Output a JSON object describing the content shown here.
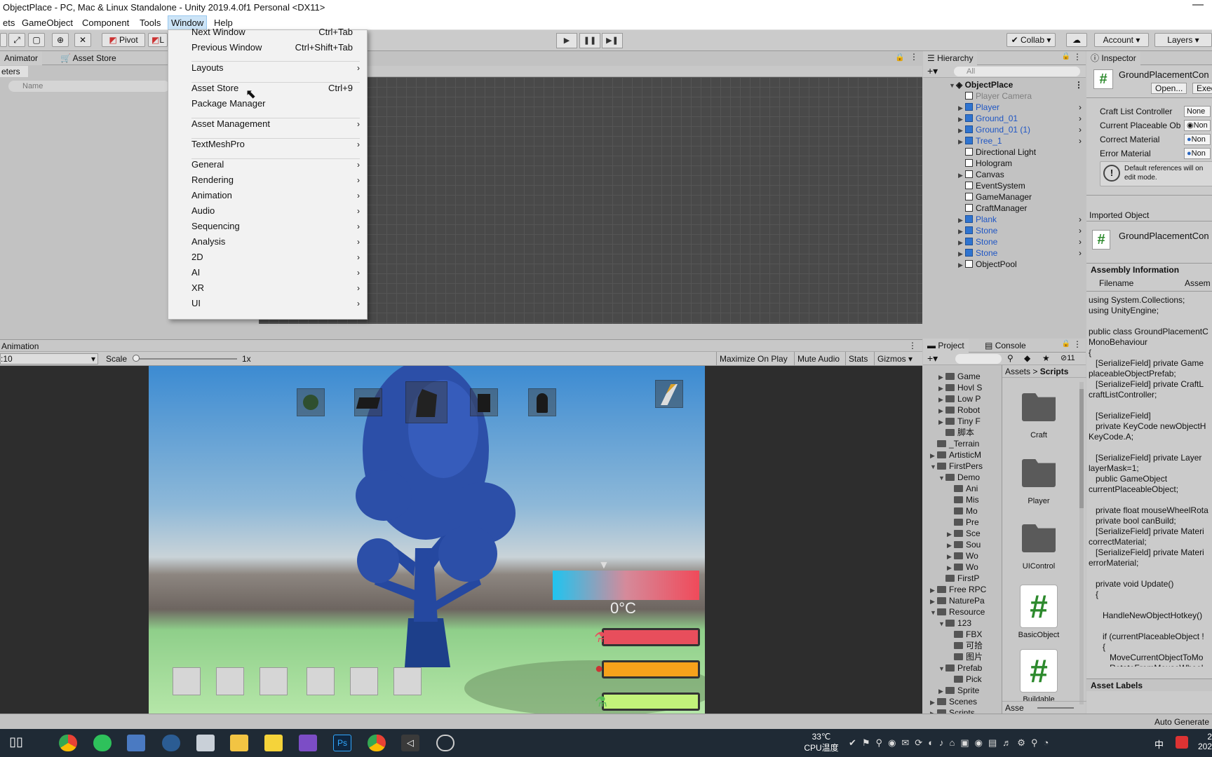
{
  "window": {
    "title": "ObjectPlace - PC, Mac & Linux Standalone - Unity 2019.4.0f1 Personal <DX11>",
    "minimize": "—"
  },
  "menu": [
    "ets",
    "GameObject",
    "Component",
    "Tools",
    "Window",
    "Help"
  ],
  "toolbar": {
    "pivot": "Pivot",
    "local": "L",
    "collab": "Collab",
    "account": "Account",
    "layers": "Layers",
    "play": "▶",
    "pause": "❚❚",
    "step": "▶❚"
  },
  "dropdown": {
    "items": [
      {
        "label": "Next Window",
        "shortcut": "Ctrl+Tab"
      },
      {
        "label": "Previous Window",
        "shortcut": "Ctrl+Shift+Tab"
      },
      {
        "label": "Layouts",
        "shortcut": "›"
      },
      {
        "label": "Asset Store",
        "shortcut": "Ctrl+9"
      },
      {
        "label": "Package Manager",
        "shortcut": ""
      },
      {
        "label": "Asset Management",
        "shortcut": "›"
      },
      {
        "label": "TextMeshPro",
        "shortcut": "›"
      },
      {
        "label": "General",
        "shortcut": "›"
      },
      {
        "label": "Rendering",
        "shortcut": "›"
      },
      {
        "label": "Animation",
        "shortcut": "›"
      },
      {
        "label": "Audio",
        "shortcut": "›"
      },
      {
        "label": "Sequencing",
        "shortcut": "›"
      },
      {
        "label": "Analysis",
        "shortcut": "›"
      },
      {
        "label": "2D",
        "shortcut": "›"
      },
      {
        "label": "AI",
        "shortcut": "›"
      },
      {
        "label": "XR",
        "shortcut": "›"
      },
      {
        "label": "UI",
        "shortcut": "›"
      }
    ]
  },
  "left_panel": {
    "tab_animator": "Animator",
    "tab_asset_store": "Asset Store",
    "params_tab": "eters",
    "name_placeholder": "Name"
  },
  "animation_panel": {
    "title": "Animation",
    "resolution": ":10",
    "scale_label": "Scale",
    "scale_value": "1x",
    "maximize": "Maximize On Play",
    "mute": "Mute Audio",
    "stats": "Stats",
    "gizmos": "Gizmos"
  },
  "game": {
    "temperature": "0°C"
  },
  "hierarchy": {
    "title": "Hierarchy",
    "search_placeholder": "All",
    "scene": "ObjectPlace",
    "items": [
      {
        "label": "Player Camera",
        "style": "gray"
      },
      {
        "label": "Player",
        "style": "blue"
      },
      {
        "label": "Ground_01",
        "style": "blue"
      },
      {
        "label": "Ground_01 (1)",
        "style": "blue"
      },
      {
        "label": "Tree_1",
        "style": "blue"
      },
      {
        "label": "Directional Light",
        "style": "normal"
      },
      {
        "label": "Hologram",
        "style": "normal"
      },
      {
        "label": "Canvas",
        "style": "normal"
      },
      {
        "label": "EventSystem",
        "style": "normal"
      },
      {
        "label": "GameManager",
        "style": "normal"
      },
      {
        "label": "CraftManager",
        "style": "normal"
      },
      {
        "label": "Plank",
        "style": "blue"
      },
      {
        "label": "Stone",
        "style": "blue"
      },
      {
        "label": "Stone",
        "style": "blue"
      },
      {
        "label": "Stone",
        "style": "blue"
      },
      {
        "label": "ObjectPool",
        "style": "normal"
      }
    ]
  },
  "inspector": {
    "title": "Inspector",
    "component": "GroundPlacementCon",
    "open": "Open...",
    "exec": "Exec",
    "fields": [
      {
        "label": "Craft List Controller",
        "value": "None ("
      },
      {
        "label": "Current Placeable Ob",
        "value": "Non"
      },
      {
        "label": "Correct Material",
        "value": "Non"
      },
      {
        "label": "Error Material",
        "value": "Non"
      }
    ],
    "note": "Default references will on\nedit mode.",
    "imported": "Imported Object",
    "imported_name": "GroundPlacementCon",
    "assembly": "Assembly Information",
    "filename": "Filename",
    "assem": "Assem",
    "asset_labels": "Asset Labels",
    "code": "using System.Collections;\nusing UnityEngine;\n\npublic class GroundPlacementC\nMonoBehaviour\n{\n   [SerializeField] private Game\nplaceableObjectPrefab;\n   [SerializeField] private CraftL\ncraftListController;\n\n   [SerializeField]\n   private KeyCode newObjectH\nKeyCode.A;\n\n   [SerializeField] private Layer\nlayerMask=1;\n   public GameObject\ncurrentPlaceableObject;\n\n   private float mouseWheelRota\n   private bool canBuild;\n   [SerializeField] private Materi\ncorrectMaterial;\n   [SerializeField] private Materi\nerrorMaterial;\n\n   private void Update()\n   {\n\n      HandleNewObjectHotkey()\n\n      if (currentPlaceableObject !\n      {\n         MoveCurrentObjectToMo\n         RotateFromMouseWheel\n         ReleaseIfClicked()"
  },
  "project": {
    "tab_project": "Project",
    "tab_console": "Console",
    "count": "11",
    "breadcrumb_root": "Assets",
    "breadcrumb_sep": ">",
    "breadcrumb_current": "Scripts",
    "tree": [
      {
        "label": "Game",
        "indent": 2,
        "arrow": "▶"
      },
      {
        "label": "Hovl S",
        "indent": 2,
        "arrow": "▶"
      },
      {
        "label": "Low P",
        "indent": 2,
        "arrow": "▶"
      },
      {
        "label": "Robot",
        "indent": 2,
        "arrow": "▶"
      },
      {
        "label": "Tiny F",
        "indent": 2,
        "arrow": "▶"
      },
      {
        "label": "脚本",
        "indent": 2,
        "arrow": ""
      },
      {
        "label": "_Terrain",
        "indent": 1,
        "arrow": ""
      },
      {
        "label": "ArtisticM",
        "indent": 1,
        "arrow": "▶"
      },
      {
        "label": "FirstPers",
        "indent": 1,
        "arrow": "▼"
      },
      {
        "label": "Demo",
        "indent": 2,
        "arrow": "▼"
      },
      {
        "label": "Ani",
        "indent": 3,
        "arrow": ""
      },
      {
        "label": "Mis",
        "indent": 3,
        "arrow": ""
      },
      {
        "label": "Mo",
        "indent": 3,
        "arrow": ""
      },
      {
        "label": "Pre",
        "indent": 3,
        "arrow": ""
      },
      {
        "label": "Sce",
        "indent": 3,
        "arrow": "▶"
      },
      {
        "label": "Sou",
        "indent": 3,
        "arrow": "▶"
      },
      {
        "label": "Wo",
        "indent": 3,
        "arrow": "▶"
      },
      {
        "label": "Wo",
        "indent": 3,
        "arrow": "▶"
      },
      {
        "label": "FirstP",
        "indent": 2,
        "arrow": ""
      },
      {
        "label": "Free RPC",
        "indent": 1,
        "arrow": "▶"
      },
      {
        "label": "NaturePa",
        "indent": 1,
        "arrow": "▶"
      },
      {
        "label": "Resource",
        "indent": 1,
        "arrow": "▼"
      },
      {
        "label": "123",
        "indent": 2,
        "arrow": "▼"
      },
      {
        "label": "FBX",
        "indent": 3,
        "arrow": ""
      },
      {
        "label": "可拾",
        "indent": 3,
        "arrow": ""
      },
      {
        "label": "图片",
        "indent": 3,
        "arrow": ""
      },
      {
        "label": "Prefab",
        "indent": 2,
        "arrow": "▼"
      },
      {
        "label": "Pick",
        "indent": 3,
        "arrow": ""
      },
      {
        "label": "Sprite",
        "indent": 2,
        "arrow": "▶"
      },
      {
        "label": "Scenes",
        "indent": 1,
        "arrow": "▶"
      },
      {
        "label": "Scripts",
        "indent": 1,
        "arrow": "▶"
      }
    ],
    "assets": [
      {
        "label": "Craft",
        "kind": "folder"
      },
      {
        "label": "Player",
        "kind": "folder"
      },
      {
        "label": "UIControl",
        "kind": "folder"
      },
      {
        "label": "BasicObject",
        "kind": "script"
      },
      {
        "label": "Buildable",
        "kind": "script"
      }
    ],
    "footer": "Asse"
  },
  "status": {
    "auto_generate": "Auto Generate"
  },
  "taskbar": {
    "temp": "33℃",
    "cpu": "CPU温度",
    "ime": "中",
    "time_top": "2",
    "time_bottom": "202"
  }
}
